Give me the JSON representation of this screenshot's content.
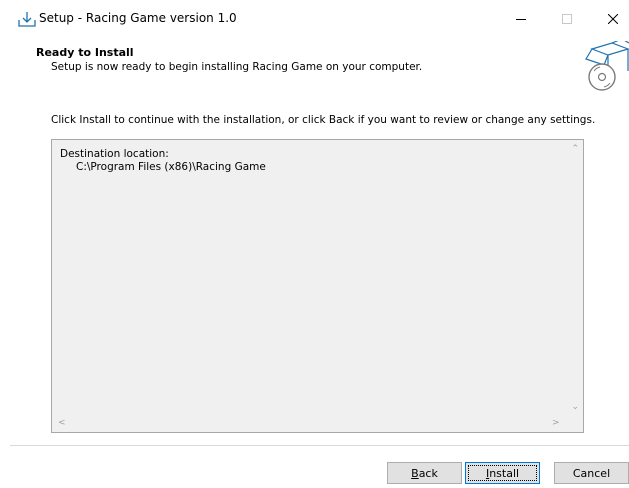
{
  "window": {
    "title": "Setup - Racing Game version 1.0"
  },
  "header": {
    "title": "Ready to Install",
    "subtitle": "Setup is now ready to begin installing Racing Game on your computer."
  },
  "instruction": "Click Install to continue with the installation, or click Back if you want to review or change any settings.",
  "memo": {
    "line1": "Destination location:",
    "line2": "C:\\Program Files (x86)\\Racing Game"
  },
  "buttons": {
    "back": {
      "accel": "B",
      "rest": "ack"
    },
    "install": {
      "accel": "I",
      "rest": "nstall"
    },
    "cancel": "Cancel"
  },
  "colors": {
    "focus_border": "#0078d7",
    "memo_bg": "#f0f0f0",
    "icon_blue": "#1e73b4"
  }
}
